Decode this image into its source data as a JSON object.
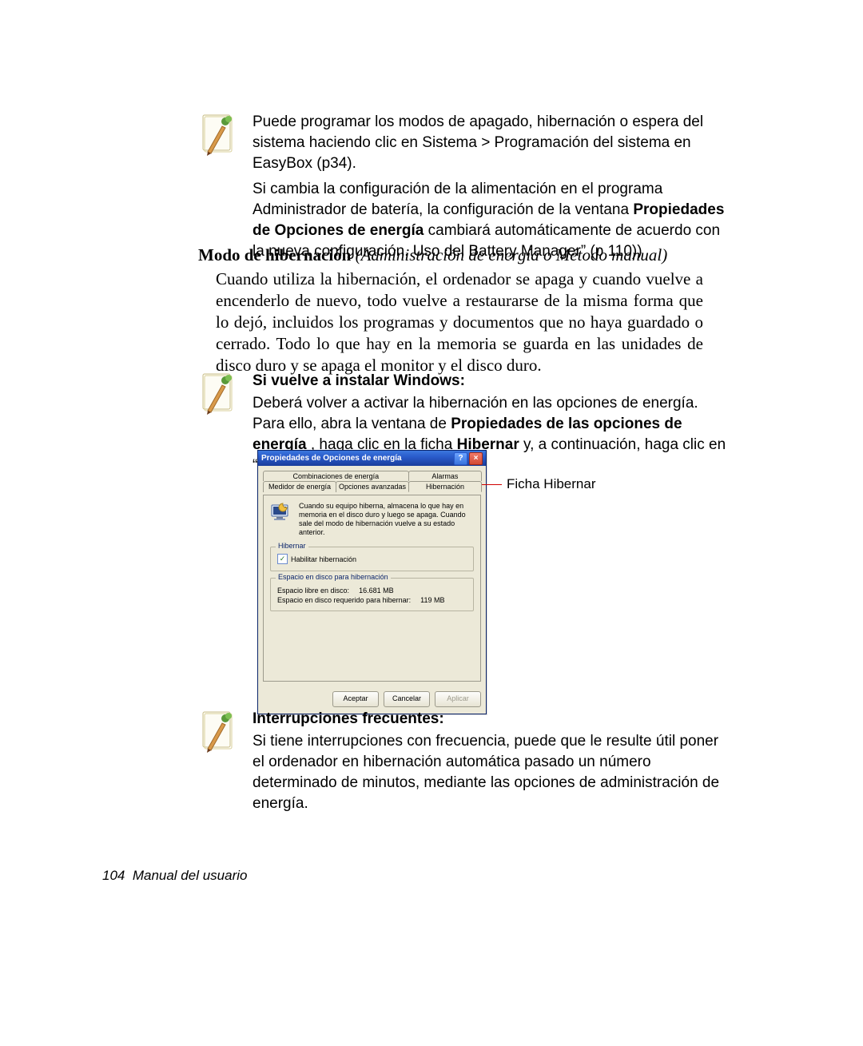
{
  "note1": {
    "line1": "Puede programar los modos de apagado, hibernación o espera del sistema haciendo clic en Sistema > Programación del sistema en EasyBox (p34).",
    "line2a": "Si cambia la configuración de la alimentación en el programa Administrador de batería, la configuración de la ventana ",
    "line2b_bold": "Propiedades de Opciones de energía",
    "line2c": " cambiará automáticamente de acuerdo con la nueva configuración. Uso del Battery Manager” (p 110))"
  },
  "section": {
    "title_bold": "Modo de hibernación",
    "title_italic": " (Administración de energía o Método manual)",
    "body": "Cuando utiliza la hibernación, el ordenador se apaga y cuando vuelve a encenderlo de nuevo, todo vuelve a restaurarse de la misma forma que lo dejó, incluidos los programas y documentos que no haya guardado o cerrado. Todo lo que hay en la memoria se guarda en las unidades de disco duro y se apaga el monitor y el disco duro."
  },
  "note2": {
    "heading": "Si vuelve a instalar Windows:",
    "t1": "Deberá volver a activar la hibernación en las opciones de energía. Para ello, abra la ventana de ",
    "t2_bold": "Propiedades de las opciones de energía",
    "t3": " , haga clic en la ficha ",
    "t4_bold": "Hibernar",
    "t5": " y, a continuación, haga clic en “Habilitar hibernación”."
  },
  "dialog": {
    "title": "Propiedades de Opciones de energía",
    "tabs_top": [
      "Combinaciones de energía",
      "Alarmas"
    ],
    "tabs_bottom": [
      "Medidor de energía",
      "Opciones avanzadas",
      "Hibernación"
    ],
    "info_text": "Cuando su equipo hiberna, almacena lo que hay en memoria en el disco duro y luego se apaga. Cuando sale del modo de hibernación vuelve a su estado anterior.",
    "group_hibernar": "Hibernar",
    "chk_label": "Habilitar hibernación",
    "group_espacio": "Espacio en disco para hibernación",
    "free_label": "Espacio libre en disco:",
    "free_value": "16.681 MB",
    "req_label": "Espacio en disco requerido para hibernar:",
    "req_value": "119 MB",
    "btn_ok": "Aceptar",
    "btn_cancel": "Cancelar",
    "btn_apply": "Aplicar"
  },
  "callout": {
    "label": "Ficha Hibernar"
  },
  "note3": {
    "heading": "Interrupciones frecuentes:",
    "body": "Si tiene interrupciones con frecuencia, puede que le resulte útil poner el ordenador en hibernación automática pasado un número determinado de minutos, mediante las opciones de administración de energía."
  },
  "footer": {
    "page": "104",
    "label": "Manual del usuario"
  }
}
